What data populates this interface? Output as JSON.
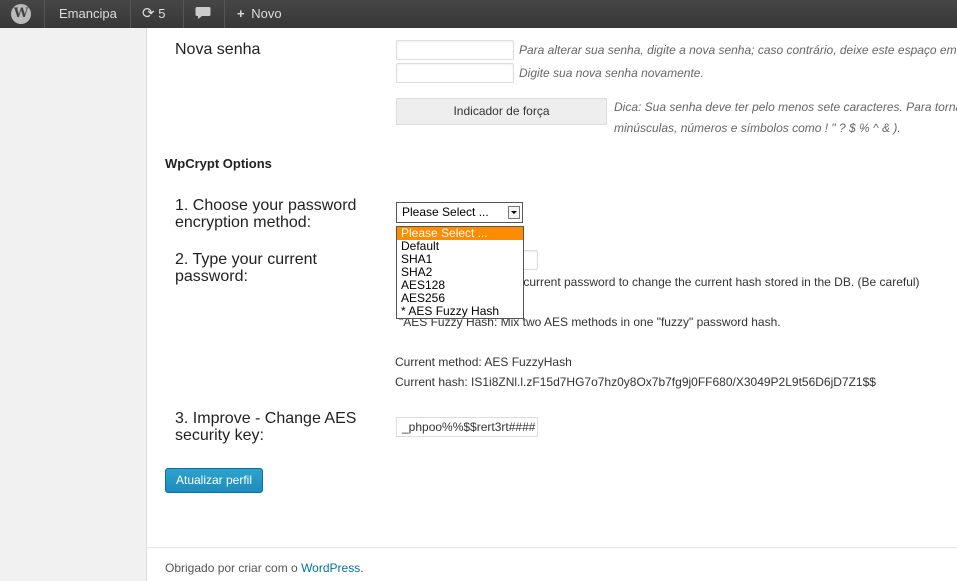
{
  "adminbar": {
    "site_name": "Emancipa",
    "updates_count": "5",
    "new_label": "Novo"
  },
  "password": {
    "label": "Nova senha",
    "hint1": "Para alterar sua senha, digite a nova senha; caso contrário, deixe este espaço em",
    "hint2": "Digite sua nova senha novamente.",
    "strength_label": "Indicador de força",
    "tip_line1": "Dica: Sua senha deve ter pelo menos sete caracteres. Para torna",
    "tip_line2": "minúsculas, números e símbolos como ! \" ? $ % ^ & )."
  },
  "wpcrypt": {
    "title": "WpCrypt Options",
    "step1_line1": "1. Choose your password",
    "step1_line2": "encryption method:",
    "select_value": "Please Select ...",
    "options": [
      "Please Select ...",
      "Default",
      "SHA1",
      "SHA2",
      "AES128",
      "AES256",
      "* AES Fuzzy Hash"
    ],
    "step2_line1": "2. Type your current",
    "step2_line2": "password:",
    "step2_hint": "r current password to change the current hash stored in the DB. (Be careful)",
    "fuzzy_note": "\"AES Fuzzy Hash: Mix two AES methods in one \"fuzzy\" password hash.",
    "current_method": "Current method: AES FuzzyHash",
    "current_hash": "Current hash: IS1i8ZNl.l.zF15d7HG7o7hz0y8Ox7b7fg9j0FF680/X3049P2L9t56D6jD7Z1$$",
    "step3_line1": "3. Improve - Change AES",
    "step3_line2": "security key:",
    "aes_key_value": "_phpoo%%$$rert3rt####"
  },
  "submit_label": "Atualizar perfil",
  "footer": {
    "text": "Obrigado por criar com o ",
    "link": "WordPress",
    "after": "."
  }
}
